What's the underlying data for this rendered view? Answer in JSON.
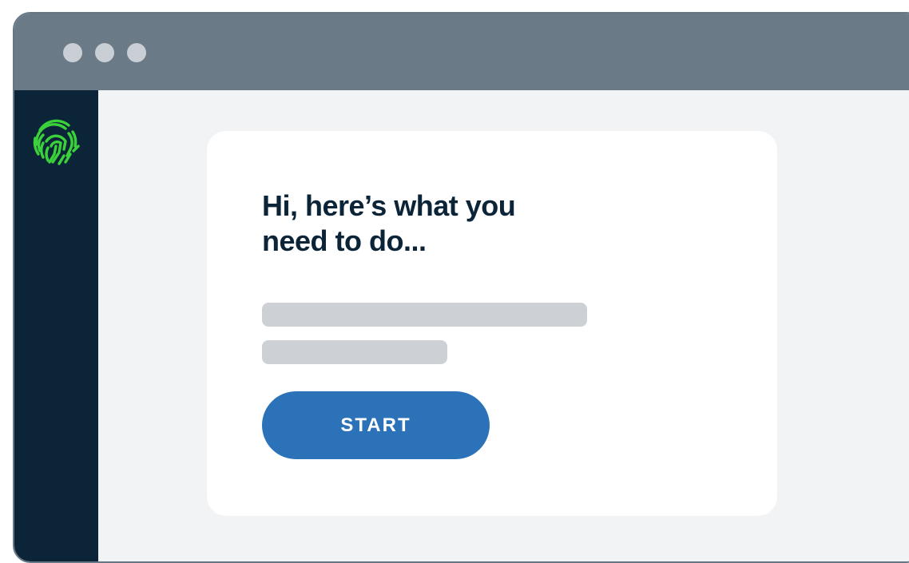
{
  "window": {
    "controls": [
      "window-dot-1",
      "window-dot-2",
      "window-dot-3"
    ]
  },
  "sidebar": {
    "logo_icon": "fingerprint-icon"
  },
  "card": {
    "heading_line_1": "Hi, here’s what you",
    "heading_line_2": "need to do...",
    "start_label": "START"
  },
  "colors": {
    "titlebar": "#6a7a87",
    "sidebar": "#0b2437",
    "accent": "#2c72b8",
    "logo_green": "#3bd13b",
    "placeholder": "#cdd1d5",
    "background": "#f2f3f5"
  }
}
